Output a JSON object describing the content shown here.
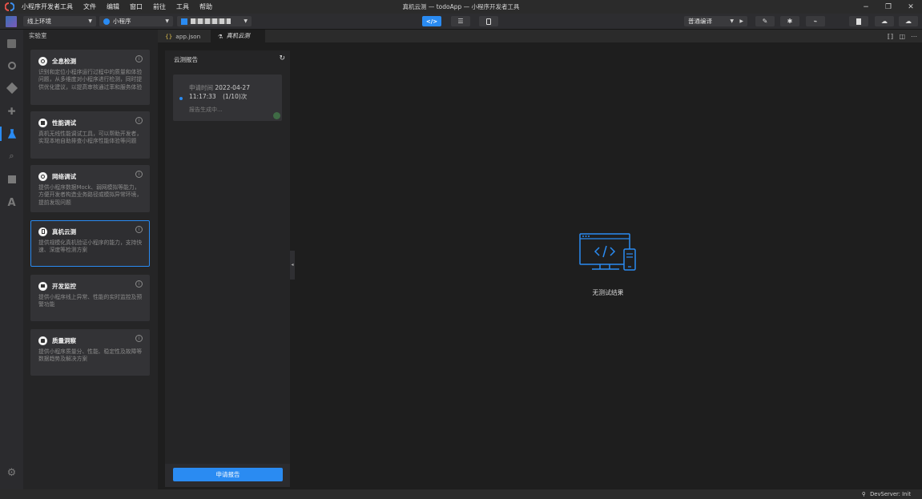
{
  "titlebar": {
    "app_name": "小程序开发者工具",
    "menus": [
      "文件",
      "编辑",
      "窗口",
      "前往",
      "工具",
      "帮助"
    ],
    "window_title": "真机云测 — todoApp — 小程序开发者工具",
    "buttons": {
      "minimize": "−",
      "restore": "❐",
      "close": "✕"
    }
  },
  "toolbar": {
    "env_select": "线上环境",
    "type_select": "小程序",
    "project_select": "",
    "compile_mode": "普通编译"
  },
  "lab_panel": {
    "title": "实验室",
    "cards": [
      {
        "title": "全息检测",
        "desc": "识别和定位小程序运行过程中的质量和体验问题，从多维度对小程序进行检测，同时提供优化建议，以提高审核通过率和服务体验",
        "icon": "scan-icon"
      },
      {
        "title": "性能调试",
        "desc": "真机无线性能调试工具，可以帮助开发者，实现本地自助排查小程序性能体验等问题",
        "icon": "gauge-icon"
      },
      {
        "title": "网络调试",
        "desc": "提供小程序数据Mock、弱网模拟等能力，方便开发者构造业务路径或模拟异常环境，提前发现问题",
        "icon": "network-icon"
      },
      {
        "title": "真机云测",
        "desc": "提供规模化真机验证小程序的能力，支持快速、深度等检测方案",
        "icon": "phone-icon"
      },
      {
        "title": "开发监控",
        "desc": "提供小程序线上异常、性能的实时监控及预警功能",
        "icon": "monitor-icon"
      },
      {
        "title": "质量洞察",
        "desc": "提供小程序质量分、性能、稳定性及故障等数据趋势及解决方案",
        "icon": "insight-icon"
      }
    ],
    "info_glyph": "i"
  },
  "tabs": {
    "app_json": "app.json",
    "app_json_icon": "{}",
    "cloud_test": "真机云测"
  },
  "report": {
    "title": "云测报告",
    "item": {
      "time_label": "申请时间",
      "date": "2022-04-27",
      "time": "11:17:33",
      "count": "(1/10)次",
      "status": "报告生成中..."
    },
    "apply_button": "申请报告"
  },
  "empty_state": {
    "text": "无测试结果"
  },
  "statusbar": {
    "devserver": "DevServer: Init"
  },
  "colors": {
    "accent": "#2a8bf2",
    "bg": "#1e1e1e",
    "panel": "#252526",
    "card": "#333336"
  }
}
